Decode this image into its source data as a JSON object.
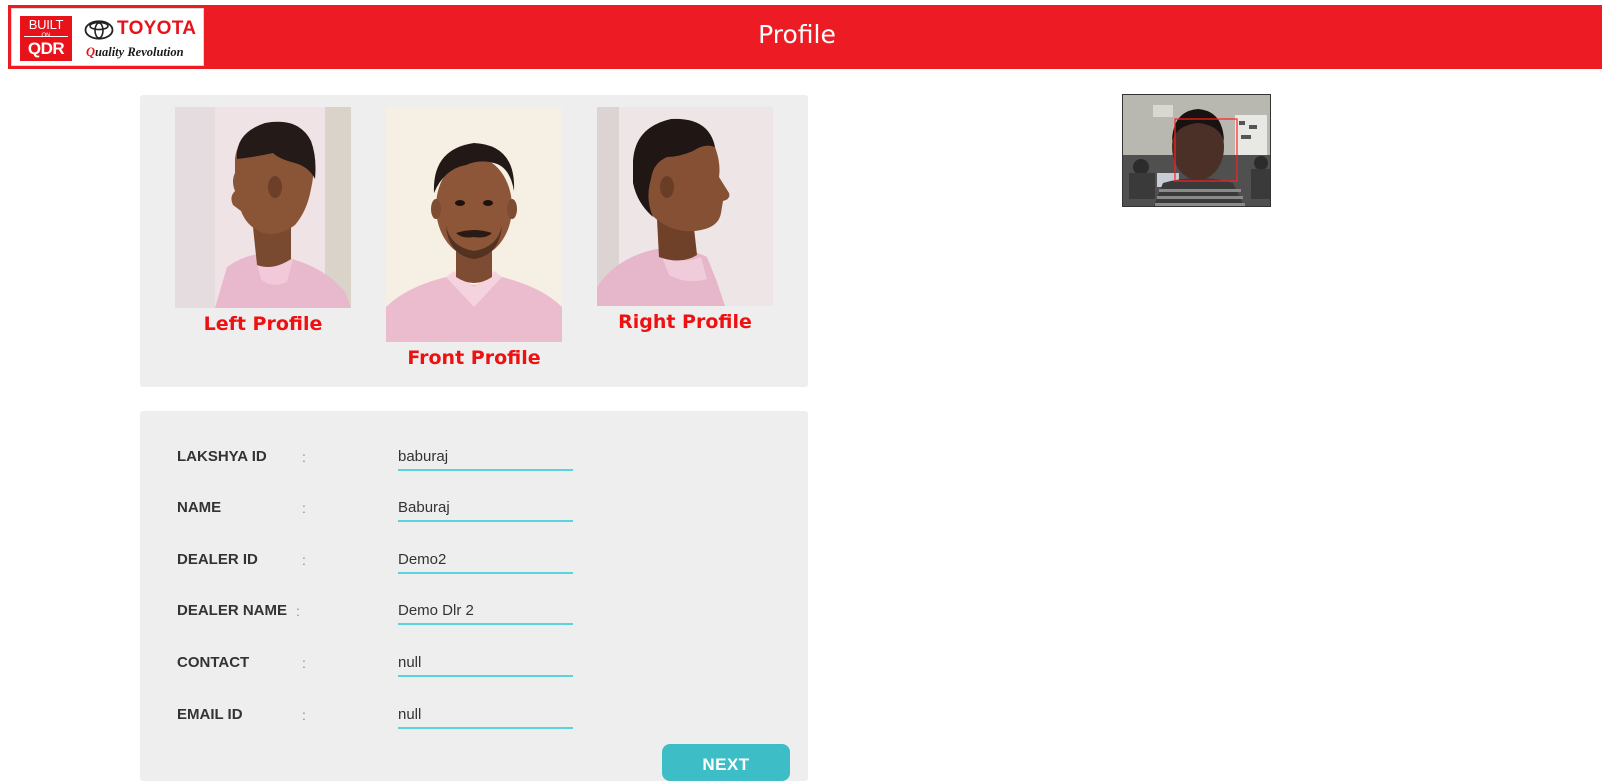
{
  "header": {
    "title": "Profile",
    "brand_color": "#ed1c24",
    "logo": {
      "badge_top": "BUILT",
      "badge_on": "ON",
      "badge_bottom": "QDR",
      "wordmark": "TOYOTA",
      "tagline_first": "Q",
      "tagline_rest": "uality Revolution"
    }
  },
  "profile_photos": {
    "left_caption": "Left Profile",
    "front_caption": "Front Profile",
    "right_caption": "Right Profile",
    "caption_color": "#ee1111"
  },
  "details": {
    "fields": [
      {
        "label": "LAKSHYA ID",
        "separator": ":",
        "value": "baburaj"
      },
      {
        "label": "NAME",
        "separator": ":",
        "value": "Baburaj"
      },
      {
        "label": "DEALER ID",
        "separator": ":",
        "value": "Demo2"
      },
      {
        "label": "DEALER NAME",
        "separator": ":",
        "value": "Demo Dlr 2"
      },
      {
        "label": "CONTACT",
        "separator": ":",
        "value": "null"
      },
      {
        "label": "EMAIL ID",
        "separator": ":",
        "value": "null"
      }
    ],
    "underline_color": "#5ad3df"
  },
  "actions": {
    "next_label": "NEXT",
    "next_color": "#3dbec7"
  },
  "webcam": {
    "face_box_color": "#ff2020"
  },
  "icons": {
    "toyota_emblem": "toyota-emblem-icon"
  }
}
